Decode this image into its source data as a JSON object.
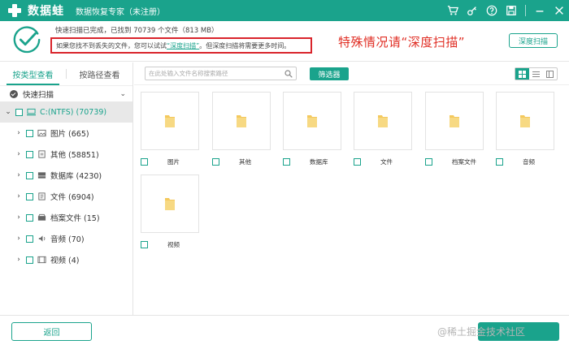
{
  "titlebar": {
    "app_name": "数据蛙",
    "subtitle": "数据恢复专家（未注册）",
    "icons": [
      "cart-icon",
      "key-icon",
      "help-icon",
      "save-icon",
      "minimize-icon",
      "close-icon"
    ]
  },
  "header": {
    "scan_status": "快速扫描已完成，已找到 70739 个文件（813 MB）",
    "hint_prefix": "如果您找不到丢失的文件，您可以试试",
    "hint_link": "“深度扫描”",
    "hint_suffix": "。但深度扫描将需要更多时间。",
    "annotation": "特殊情况请“深度扫描”",
    "deep_scan_button": "深度扫描"
  },
  "sidebar": {
    "tabs": [
      {
        "label": "按类型查看",
        "active": true
      },
      {
        "label": "按路径查看",
        "active": false
      }
    ],
    "quick_scan_label": "快速扫描",
    "root": {
      "label": "C:(NTFS) (70739)"
    },
    "items": [
      {
        "label": "图片 (665)",
        "icon": "image-icon"
      },
      {
        "label": "其他 (58851)",
        "icon": "file-icon"
      },
      {
        "label": "数据库 (4230)",
        "icon": "database-icon"
      },
      {
        "label": "文件 (6904)",
        "icon": "document-icon"
      },
      {
        "label": "档案文件 (15)",
        "icon": "archive-icon"
      },
      {
        "label": "音频 (70)",
        "icon": "audio-icon"
      },
      {
        "label": "视频 (4)",
        "icon": "video-icon"
      }
    ]
  },
  "toolbar": {
    "search_placeholder": "在此处输入文件名称搜索路径",
    "filter_button": "筛选器",
    "active_view": "grid"
  },
  "tiles": [
    {
      "label": "图片"
    },
    {
      "label": "其他"
    },
    {
      "label": "数据库"
    },
    {
      "label": "文件"
    },
    {
      "label": "档案文件"
    },
    {
      "label": "音频"
    },
    {
      "label": "视频"
    }
  ],
  "bottom": {
    "back_button": "返回",
    "watermark": "@稀土掘金技术社区"
  },
  "colors": {
    "brand": "#1aa38c",
    "annotation_red": "#e02e24",
    "folder": "#f4c95d"
  }
}
